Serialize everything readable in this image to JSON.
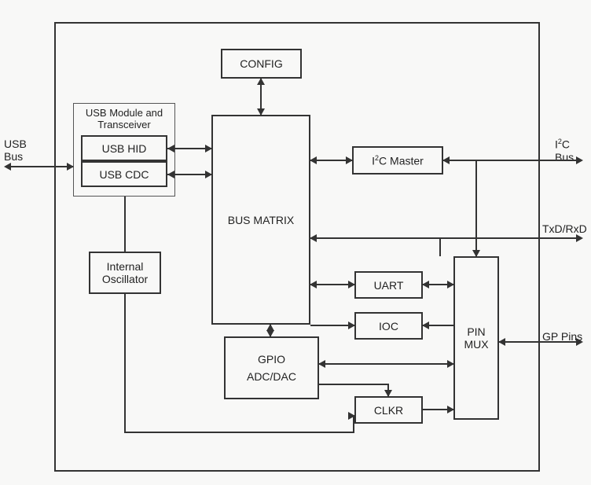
{
  "external_labels": {
    "usb_bus": "USB\nBus",
    "i2c_bus": "I²C\nBus",
    "txd_rxd": "TxD/RxD",
    "gp_pins": "GP Pins"
  },
  "usb_module": {
    "title": "USB Module and\nTransceiver",
    "hid": "USB HID",
    "cdc": "USB CDC"
  },
  "blocks": {
    "config": "CONFIG",
    "bus_matrix": "BUS MATRIX",
    "i2c_master": "I²C Master",
    "internal_oscillator": "Internal\nOscillator",
    "uart": "UART",
    "ioc": "IOC",
    "gpio_adcdac": "GPIO\nADC/DAC",
    "clkr": "CLKR",
    "pin_mux": "PIN\nMUX"
  },
  "chart_data": {
    "type": "block-diagram",
    "nodes": [
      {
        "id": "chip",
        "label": "chip-boundary",
        "container": true
      },
      {
        "id": "usb_module",
        "label": "USB Module and Transceiver",
        "children": [
          "usb_hid",
          "usb_cdc"
        ]
      },
      {
        "id": "usb_hid",
        "label": "USB HID"
      },
      {
        "id": "usb_cdc",
        "label": "USB CDC"
      },
      {
        "id": "config",
        "label": "CONFIG"
      },
      {
        "id": "bus_matrix",
        "label": "BUS MATRIX"
      },
      {
        "id": "i2c_master",
        "label": "I²C Master"
      },
      {
        "id": "internal_oscillator",
        "label": "Internal Oscillator"
      },
      {
        "id": "uart",
        "label": "UART"
      },
      {
        "id": "ioc",
        "label": "IOC"
      },
      {
        "id": "gpio_adcdac",
        "label": "GPIO ADC/DAC"
      },
      {
        "id": "clkr",
        "label": "CLKR"
      },
      {
        "id": "pin_mux",
        "label": "PIN MUX"
      }
    ],
    "external_ports": [
      {
        "id": "ext_usb",
        "label": "USB Bus",
        "side": "left"
      },
      {
        "id": "ext_i2c",
        "label": "I²C Bus",
        "side": "right"
      },
      {
        "id": "ext_uart",
        "label": "TxD/RxD",
        "side": "right"
      },
      {
        "id": "ext_gp",
        "label": "GP Pins",
        "side": "right"
      }
    ],
    "edges": [
      {
        "from": "ext_usb",
        "to": "usb_module",
        "dir": "both"
      },
      {
        "from": "usb_hid",
        "to": "bus_matrix",
        "dir": "both"
      },
      {
        "from": "usb_cdc",
        "to": "bus_matrix",
        "dir": "both"
      },
      {
        "from": "config",
        "to": "bus_matrix",
        "dir": "both"
      },
      {
        "from": "bus_matrix",
        "to": "i2c_master",
        "dir": "both"
      },
      {
        "from": "i2c_master",
        "to": "ext_i2c",
        "dir": "both"
      },
      {
        "from": "i2c_master",
        "to": "pin_mux",
        "dir": "forward"
      },
      {
        "from": "bus_matrix",
        "to": "uart",
        "dir": "both"
      },
      {
        "from": "uart",
        "to": "pin_mux",
        "dir": "both"
      },
      {
        "from": "pin_mux",
        "to": "ext_uart",
        "dir": "both"
      },
      {
        "from": "bus_matrix",
        "to": "ioc",
        "dir": "forward"
      },
      {
        "from": "pin_mux",
        "to": "ioc",
        "dir": "forward"
      },
      {
        "from": "bus_matrix",
        "to": "gpio_adcdac",
        "dir": "both"
      },
      {
        "from": "gpio_adcdac",
        "to": "pin_mux",
        "dir": "both"
      },
      {
        "from": "gpio_adcdac",
        "to": "clkr",
        "dir": "forward"
      },
      {
        "from": "clkr",
        "to": "pin_mux",
        "dir": "forward"
      },
      {
        "from": "pin_mux",
        "to": "ext_gp",
        "dir": "both"
      },
      {
        "from": "usb_module",
        "to": "internal_oscillator",
        "dir": "none"
      },
      {
        "from": "internal_oscillator",
        "to": "clkr",
        "dir": "forward"
      }
    ]
  }
}
